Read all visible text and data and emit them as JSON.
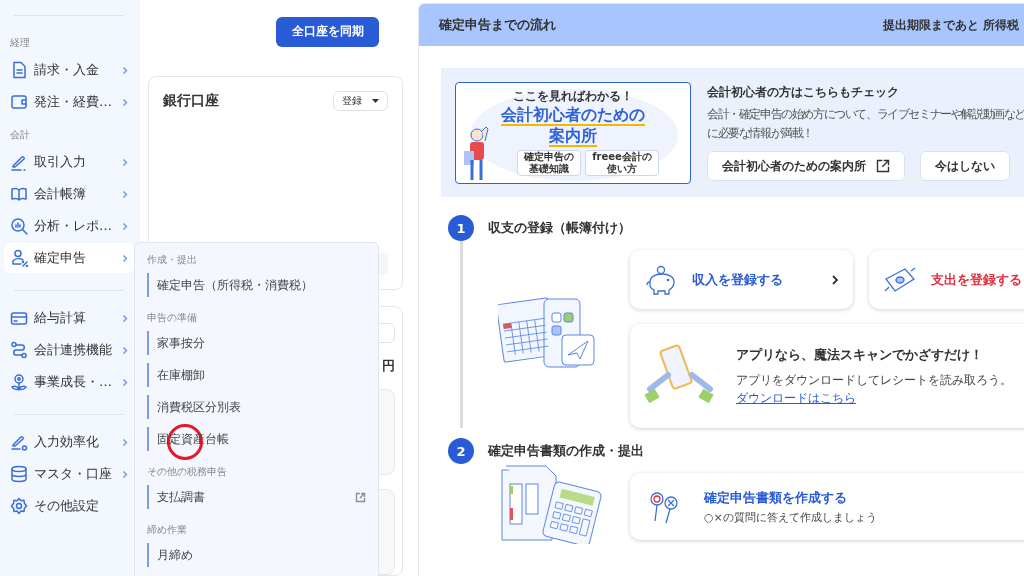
{
  "sidebar": {
    "sections": [
      {
        "label": "経理",
        "items": [
          {
            "label": "請求・入金",
            "has_submenu": true,
            "selected": false
          },
          {
            "label": "発注・経費…",
            "has_submenu": true,
            "selected": false
          }
        ]
      },
      {
        "label": "会計",
        "items": [
          {
            "label": "取引入力",
            "has_submenu": true,
            "selected": false
          },
          {
            "label": "会計帳簿",
            "has_submenu": true,
            "selected": false
          },
          {
            "label": "分析・レポ…",
            "has_submenu": true,
            "selected": false
          },
          {
            "label": "確定申告",
            "has_submenu": true,
            "selected": true
          }
        ]
      },
      {
        "items": [
          {
            "label": "給与計算",
            "has_submenu": true,
            "selected": false
          },
          {
            "label": "会計連携機能",
            "has_submenu": true,
            "selected": false
          },
          {
            "label": "事業成長・…",
            "has_submenu": true,
            "selected": false
          }
        ]
      },
      {
        "items": [
          {
            "label": "入力効率化",
            "has_submenu": true,
            "selected": false
          },
          {
            "label": "マスタ・口座",
            "has_submenu": true,
            "selected": false
          },
          {
            "label": "その他設定",
            "has_submenu": false,
            "selected": false
          }
        ]
      }
    ]
  },
  "flyout_menu": {
    "groups": [
      {
        "label": "作成・提出",
        "items": [
          {
            "label": "確定申告（所得税・消費税）",
            "external": false
          }
        ]
      },
      {
        "label": "申告の準備",
        "items": [
          {
            "label": "家事按分",
            "external": false
          },
          {
            "label": "在庫棚卸",
            "external": false
          },
          {
            "label": "消費税区分別表",
            "external": false
          },
          {
            "label": "固定資産台帳",
            "external": false
          }
        ]
      },
      {
        "label": "その他の税務申告",
        "items": [
          {
            "label": "支払調書",
            "external": true
          }
        ]
      },
      {
        "label": "締め作業",
        "items": [
          {
            "label": "月締め",
            "external": false
          }
        ]
      }
    ]
  },
  "sync_button": "全口座を同期",
  "bank_card": {
    "title": "銀行口座",
    "dropdown": "登録"
  },
  "summary_card": {
    "unit": "円"
  },
  "flow_panel": {
    "title": "確定申告までの流れ",
    "deadline": "提出期限まであと 所得税",
    "guide_banner": {
      "art": {
        "tagline": "ここを見ればわかる！",
        "title_lines": [
          "会計初心者のための",
          "案内所"
        ],
        "chips": [
          [
            "確定申告の",
            "基礎知識"
          ],
          [
            "freee会計の",
            "使い方"
          ]
        ]
      },
      "heading": "会計初心者の方はこちらもチェック",
      "description_lines": [
        "会計・確定申告の始め方について、ライブセミナーや解説動画など",
        "に必要な情報が満載！"
      ],
      "buttons": [
        {
          "label": "会計初心者のための案内所",
          "external": true
        },
        {
          "label": "今はしない",
          "external": false
        }
      ]
    },
    "steps": [
      {
        "number": "1",
        "title": "収支の登録（帳簿付け）",
        "cards": [
          {
            "kind": "action",
            "label": "収入を登録する",
            "color": "#2a5bd7",
            "chevron": true
          },
          {
            "kind": "action",
            "label": "支出を登録する",
            "color": "#e0303f",
            "chevron": false
          },
          {
            "kind": "promo",
            "title": "アプリなら、魔法スキャンでかざすだけ！",
            "text": "アプリをダウンロードしてレシートを読み取ろう。",
            "link": "ダウンロードはこちら"
          }
        ]
      },
      {
        "number": "2",
        "title": "確定申告書類の作成・提出",
        "cards": [
          {
            "kind": "task",
            "title": "確定申告書類を作成する",
            "text": "○×の質問に答えて作成しましょう"
          }
        ]
      }
    ]
  }
}
